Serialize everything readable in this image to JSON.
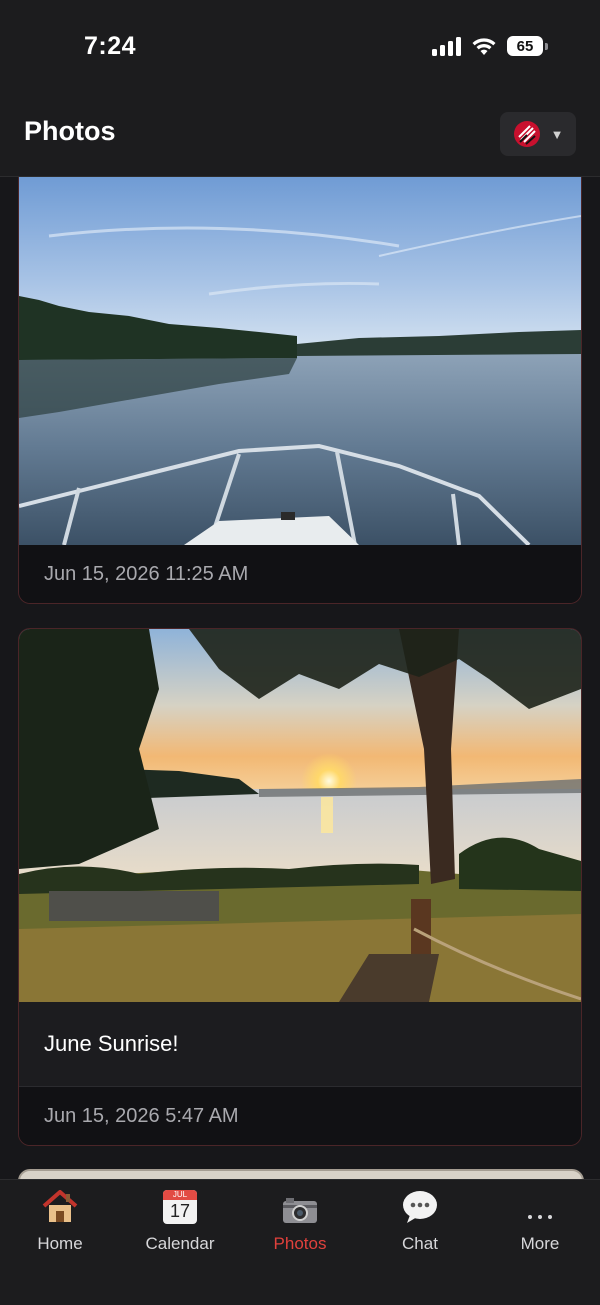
{
  "status_bar": {
    "time": "7:24",
    "battery": "65"
  },
  "header": {
    "title": "Photos"
  },
  "feed": {
    "items": [
      {
        "date": "Jun 15, 2026 11:25 AM",
        "caption": "",
        "photo_icon": "lake-boat-photo"
      },
      {
        "date": "Jun 15, 2026 5:47 AM",
        "caption": "June Sunrise!",
        "photo_icon": "sunrise-lake-photo"
      }
    ]
  },
  "tab_bar": {
    "tabs": [
      {
        "label": "Home",
        "icon": "house-icon"
      },
      {
        "label": "Calendar",
        "icon": "calendar-icon",
        "month": "JUL",
        "day": "17"
      },
      {
        "label": "Photos",
        "icon": "camera-icon",
        "active": true
      },
      {
        "label": "Chat",
        "icon": "speech-bubble-icon"
      },
      {
        "label": "More",
        "icon": "ellipsis-icon"
      }
    ]
  },
  "colors": {
    "accent": "#e0413c",
    "background": "#17171a",
    "card_border": "#4b2528"
  }
}
